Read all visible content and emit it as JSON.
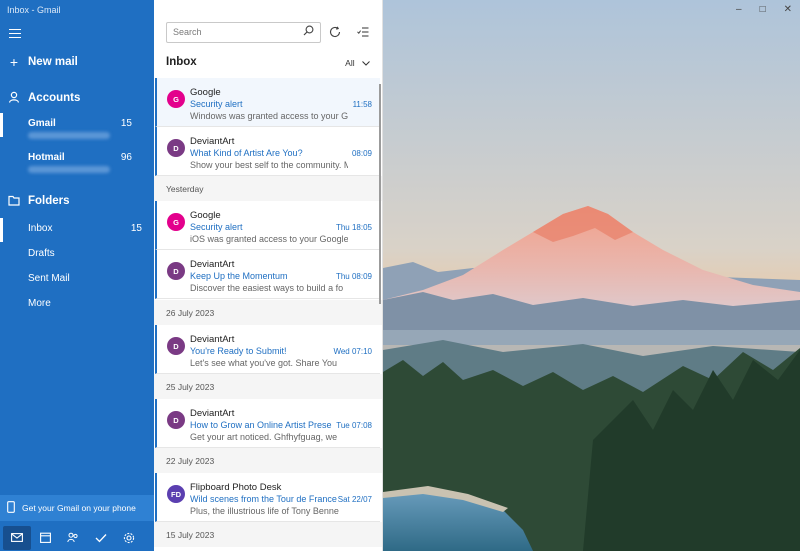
{
  "window": {
    "title": "Inbox - Gmail",
    "minimize": "–",
    "maximize": "□",
    "close": "✕"
  },
  "nav": {
    "new_mail": "New mail",
    "accounts_label": "Accounts",
    "accounts": [
      {
        "name": "Gmail",
        "count": "15",
        "selected": true
      },
      {
        "name": "Hotmail",
        "count": "96",
        "selected": false
      }
    ],
    "folders_label": "Folders",
    "folders": [
      {
        "name": "Inbox",
        "count": "15"
      },
      {
        "name": "Drafts",
        "count": ""
      },
      {
        "name": "Sent Mail",
        "count": ""
      },
      {
        "name": "More",
        "count": ""
      }
    ],
    "promo": "Get your Gmail on your phone",
    "bottom_icons": [
      "mail-icon",
      "calendar-icon",
      "people-icon",
      "todo-icon",
      "settings-icon"
    ]
  },
  "list": {
    "search_placeholder": "Search",
    "title": "Inbox",
    "filter": "All",
    "items": [
      {
        "initial": "G",
        "color": "#e3008c",
        "sender": "Google",
        "subject": "Security alert",
        "time": "11:58",
        "preview": "Windows was granted access to your Goo"
      },
      {
        "initial": "D",
        "color": "#7a3a84",
        "sender": "DeviantArt",
        "subject": "What Kind of Artist Are You?",
        "time": "08:09",
        "preview": "Show your best self to the community. M"
      },
      {
        "divider": "Yesterday"
      },
      {
        "initial": "G",
        "color": "#e3008c",
        "sender": "Google",
        "subject": "Security alert",
        "time": "Thu 18:05",
        "preview": "iOS was granted access to your Google"
      },
      {
        "initial": "D",
        "color": "#7a3a84",
        "sender": "DeviantArt",
        "subject": "Keep Up the Momentum",
        "time": "Thu 08:09",
        "preview": "Discover the easiest ways to build a fo"
      },
      {
        "divider": "26 July 2023"
      },
      {
        "initial": "D",
        "color": "#7a3a84",
        "sender": "DeviantArt",
        "subject": "You're Ready to Submit!",
        "time": "Wed 07:10",
        "preview": "Let's see what you've got. Share You"
      },
      {
        "divider": "25 July 2023"
      },
      {
        "initial": "D",
        "color": "#7a3a84",
        "sender": "DeviantArt",
        "subject": "How to Grow an Online Artist Prese",
        "time": "Tue 07:08",
        "preview": "Get your art noticed. Ghfhyfguag, we"
      },
      {
        "divider": "22 July 2023"
      },
      {
        "initial": "FD",
        "color": "#5b3fb0",
        "sender": "Flipboard Photo Desk",
        "subject": "Wild scenes from the Tour de France",
        "time": "Sat 22/07",
        "preview": "Plus, the illustrious life of Tony Benne"
      },
      {
        "divider": "15 July 2023"
      }
    ]
  }
}
